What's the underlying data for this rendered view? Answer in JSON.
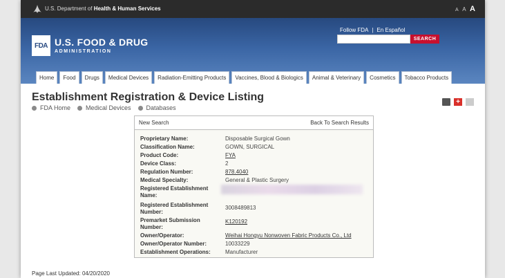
{
  "hhs": {
    "prefix": "U.S. Department of ",
    "name": "Health & Human Services",
    "text_sizes": [
      "A",
      "A",
      "A"
    ]
  },
  "header": {
    "logo_text": "FDA",
    "agency_name": "U.S. FOOD & DRUG",
    "agency_sub": "ADMINISTRATION",
    "follow_fda": "Follow FDA",
    "separator": "|",
    "espanol": "En Español",
    "search_button": "SEARCH"
  },
  "nav": {
    "tabs": [
      {
        "label": "Home"
      },
      {
        "label": "Food"
      },
      {
        "label": "Drugs"
      },
      {
        "label": "Medical Devices"
      },
      {
        "label": "Radiation-Emitting Products"
      },
      {
        "label": "Vaccines, Blood & Biologics"
      },
      {
        "label": "Animal & Veterinary"
      },
      {
        "label": "Cosmetics"
      },
      {
        "label": "Tobacco Products"
      }
    ]
  },
  "page": {
    "title": "Establishment Registration & Device Listing",
    "breadcrumbs": [
      "FDA Home",
      "Medical Devices",
      "Databases"
    ],
    "last_updated": "Page Last Updated: 04/20/2020"
  },
  "panel": {
    "new_search": "New Search",
    "back_link": "Back To Search Results",
    "rows": [
      {
        "label": "Proprietary Name:",
        "value": "Disposable Surgical Gown"
      },
      {
        "label": "Classification Name:",
        "value": "GOWN, SURGICAL"
      },
      {
        "label": "Product Code:",
        "value": "FYA"
      },
      {
        "label": "Device Class:",
        "value": "2"
      },
      {
        "label": "Regulation Number:",
        "value": "878.4040"
      },
      {
        "label": "Medical Specialty:",
        "value": "General & Plastic Surgery"
      },
      {
        "label": "Registered Establishment Name:",
        "value": ""
      },
      {
        "label": "Registered Establishment Number:",
        "value": "3008489813"
      },
      {
        "label": "Premarket Submission Number:",
        "value": "K120192"
      },
      {
        "label": "Owner/Operator:",
        "value": "Weihai Hongyu Nonwoven Fabric Products Co., Ltd"
      },
      {
        "label": "Owner/Operator Number:",
        "value": "10033229"
      },
      {
        "label": "Establishment Operations:",
        "value": "Manufacturer"
      }
    ]
  },
  "colors": {
    "banner": "#3a65a4",
    "search_button": "#c8102e",
    "hhs_bar": "#2b2b2b"
  }
}
